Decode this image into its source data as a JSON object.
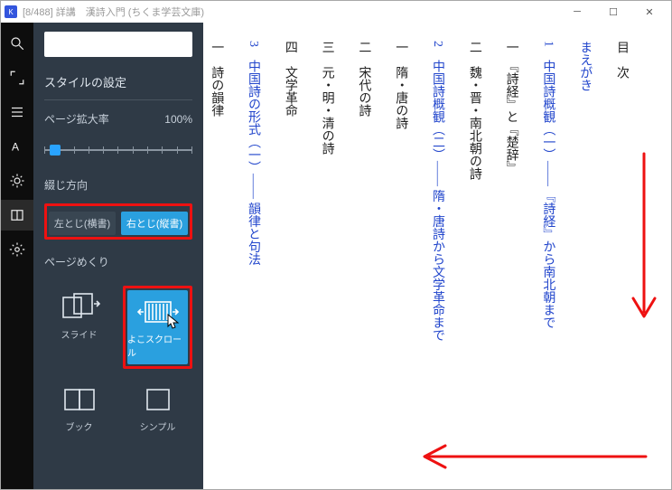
{
  "titlebar": {
    "text": "[8/488]  詳講　漢詩入門 (ちくま学芸文庫)"
  },
  "search": {
    "placeholder": ""
  },
  "panel": {
    "heading": "スタイルの設定",
    "zoom_label": "ページ拡大率",
    "zoom_value": "100%",
    "binding_label": "綴じ方向",
    "binding_left": "左とじ(横書)",
    "binding_right": "右とじ(縦書)",
    "paging_label": "ページめくり",
    "opt_slide": "スライド",
    "opt_hscroll": "よこスクロール",
    "opt_book": "ブック",
    "opt_simple": "シンプル"
  },
  "toc": {
    "c0": "目　次",
    "c1": "まえがき",
    "c2a": "1",
    "c2b": "　中国詩概観（一）―― 『詩経』から南北朝まで",
    "c3": "一　『詩経』と『楚辞』",
    "c4": "二　魏・晋・南北朝の詩",
    "c5a": "2",
    "c5b": "　中国詩概観（二）―― 隋・唐詩から文学革命まで",
    "c6": "一　隋・唐の詩",
    "c7": "二　宋代の詩",
    "c8": "三　元・明・清の詩",
    "c9": "四　文学革命",
    "c10a": "3",
    "c10b": "　中国詩の形式（一）―― 韻律と句法",
    "c11": "一　詩の韻律"
  }
}
